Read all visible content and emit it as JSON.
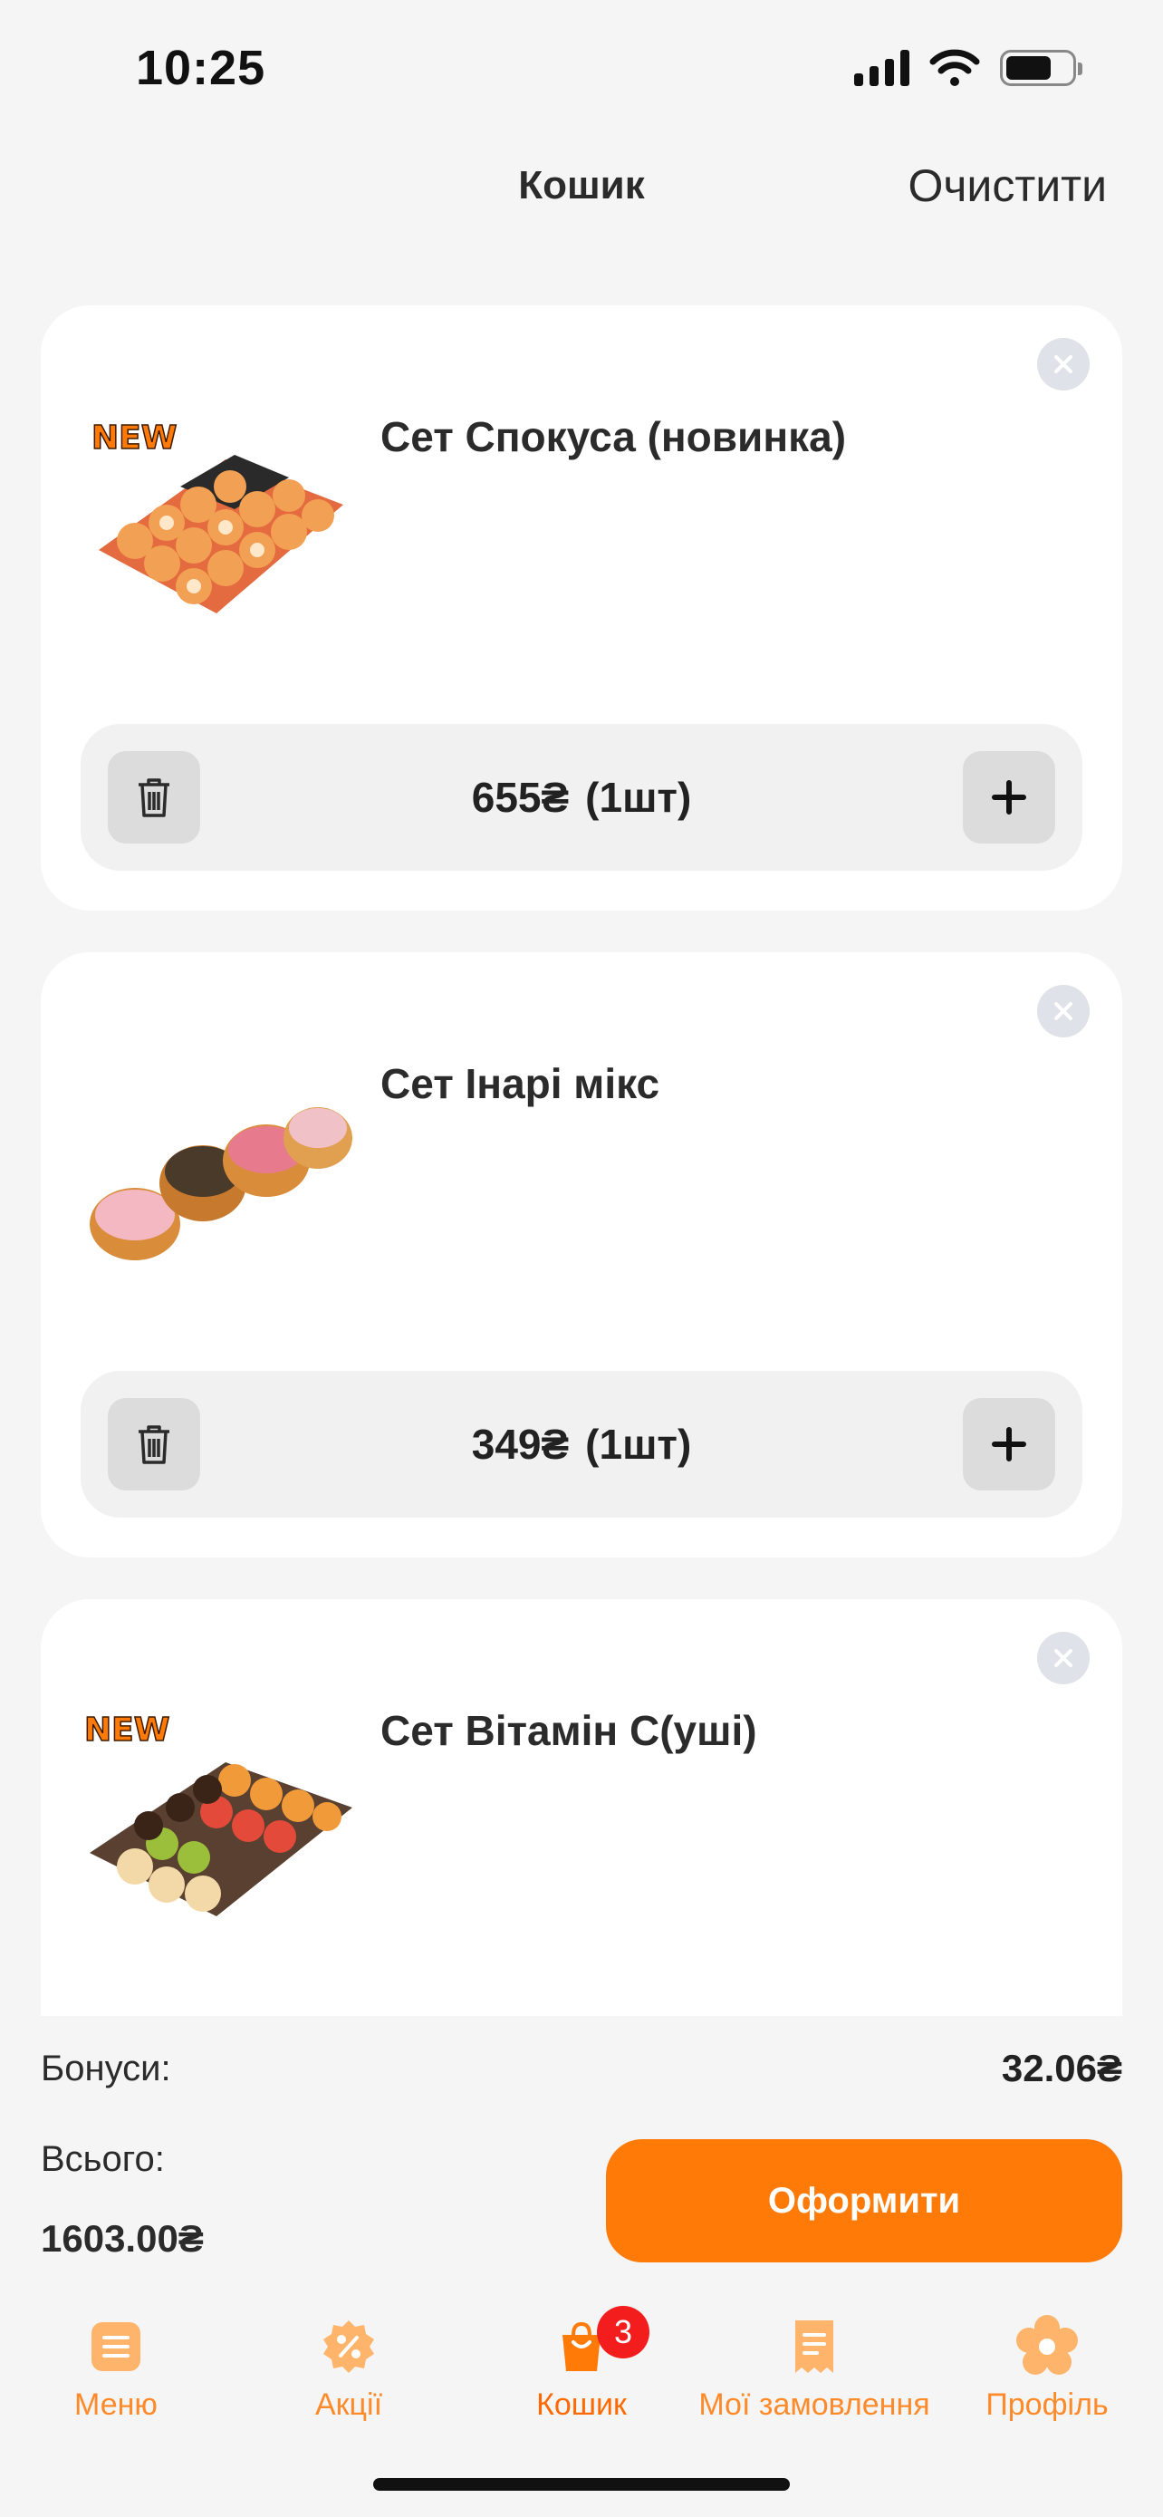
{
  "status_bar": {
    "time": "10:25",
    "battery_level": 0.7
  },
  "header": {
    "title": "Кошик",
    "clear_label": "Очистити"
  },
  "cart": {
    "items": [
      {
        "name": "Сет Спокуса (новинка)",
        "price": "655₴",
        "quantity": "(1шт)",
        "badge": "NEW"
      },
      {
        "name": "Сет Інарі мікс",
        "price": "349₴",
        "quantity": "(1шт)",
        "badge": ""
      },
      {
        "name": "Сет Вітамін С(уші)",
        "price": "",
        "quantity": "",
        "badge": "NEW"
      }
    ]
  },
  "summary": {
    "bonus_label": "Бонуси:",
    "bonus_value": "32.06₴",
    "total_label": "Всього:",
    "total_value": "1603.00₴",
    "checkout_label": "Оформити"
  },
  "tabs": [
    {
      "label": "Меню",
      "icon": "menu-icon"
    },
    {
      "label": "Акції",
      "icon": "discount-icon"
    },
    {
      "label": "Кошик",
      "icon": "cart-bag-icon",
      "badge": "3"
    },
    {
      "label": "Мої замовлення",
      "icon": "receipt-icon"
    },
    {
      "label": "Профіль",
      "icon": "profile-flower-icon"
    }
  ],
  "colors": {
    "accent": "#ff7a07",
    "tab_icon": "#ffb46b",
    "badge": "#f31d1d"
  }
}
